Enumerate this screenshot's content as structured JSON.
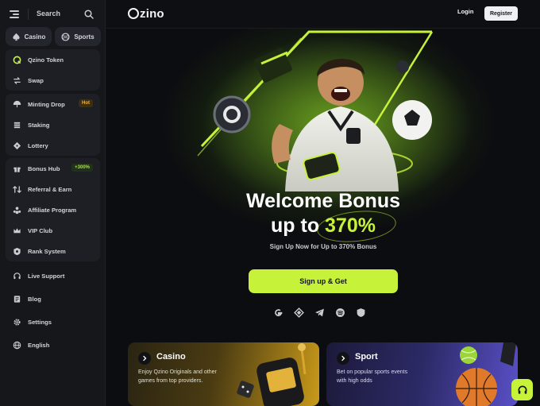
{
  "sidebar": {
    "search_label": "Search",
    "categories": [
      {
        "label": "Casino",
        "icon": "spade-icon"
      },
      {
        "label": "Sports",
        "icon": "ball-icon"
      }
    ],
    "group1": [
      {
        "label": "Qzino Token",
        "icon": "qzino-token-icon"
      },
      {
        "label": "Swap",
        "icon": "swap-icon"
      }
    ],
    "group2": [
      {
        "label": "Minting Drop",
        "icon": "drop-icon",
        "badge": "Hot"
      },
      {
        "label": "Staking",
        "icon": "staking-icon"
      },
      {
        "label": "Lottery",
        "icon": "ticket-icon"
      }
    ],
    "group3": [
      {
        "label": "Bonus Hub",
        "icon": "gift-icon",
        "badge": "+300%"
      },
      {
        "label": "Referral & Earn",
        "icon": "referral-icon"
      },
      {
        "label": "Affiliate Program",
        "icon": "affiliate-icon"
      },
      {
        "label": "VIP Club",
        "icon": "crown-icon"
      },
      {
        "label": "Rank System",
        "icon": "rank-icon"
      }
    ],
    "plain": [
      {
        "label": "Live Support",
        "icon": "headset-icon"
      },
      {
        "label": "Blog",
        "icon": "blog-icon"
      },
      {
        "label": "Settings",
        "icon": "gear-icon"
      },
      {
        "label": "English",
        "icon": "globe-icon"
      }
    ]
  },
  "header": {
    "logo_text": "zino",
    "login_label": "Login",
    "register_label": "Register"
  },
  "hero": {
    "title": "Welcome Bonus",
    "subtitle_prefix": "up to ",
    "subtitle_amount": "370%",
    "description": "Sign Up Now for Up to 370% Bonus",
    "cta_label": "Sign up & Get",
    "social_icons": [
      "google-icon",
      "wallet-icon",
      "telegram-icon",
      "spotify-icon",
      "shield-icon"
    ]
  },
  "cards": [
    {
      "title": "Casino",
      "description": "Enjoy Qzino Originals and other games from top providers."
    },
    {
      "title": "Sport",
      "description": "Bet on popular sports events with high odds"
    }
  ],
  "colors": {
    "accent": "#c6f23a",
    "background": "#0e0f12",
    "sidebar": "#15171b",
    "hot_badge": "#f2b23c"
  }
}
